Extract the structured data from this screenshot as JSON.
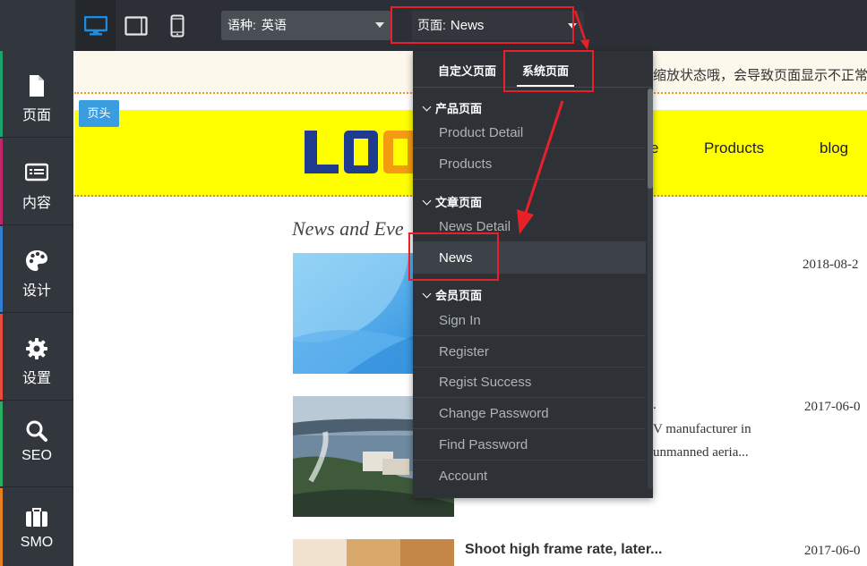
{
  "toolbar": {
    "devices": [
      "desktop-icon",
      "tablet-icon",
      "mobile-icon"
    ],
    "language_label": "语种:",
    "language_value": "英语",
    "page_label": "页面:",
    "page_value": "News"
  },
  "sidebar": {
    "items": [
      {
        "label": "页面",
        "icon": "page-icon",
        "accent": "#1aa36d"
      },
      {
        "label": "内容",
        "icon": "content-icon",
        "accent": "#c0266a"
      },
      {
        "label": "设计",
        "icon": "palette-icon",
        "accent": "#2f7fd6"
      },
      {
        "label": "设置",
        "icon": "gear-icon",
        "accent": "#e74c3c"
      },
      {
        "label": "SEO",
        "icon": "search-icon",
        "accent": "#27ae60"
      },
      {
        "label": "SMO",
        "icon": "briefcase-icon",
        "accent": "#e67e22"
      }
    ]
  },
  "canvas": {
    "notice_text": "缩放状态哦，会导致页面显示不正常",
    "header_tag": "页头",
    "logo_text": "LOO",
    "nav": [
      "e",
      "Products",
      "blog"
    ],
    "news_heading": "News and Eve",
    "dates": [
      "2018-08-2",
      "2017-06-0",
      "2017-06-0"
    ],
    "news_snippet_lines": [
      ".",
      "V manufacturer in",
      "unmanned aeria..."
    ],
    "news_title_3": "Shoot high frame rate, later..."
  },
  "dropdown": {
    "tabs": [
      "自定义页面",
      "系统页面"
    ],
    "active_tab": "系统页面",
    "groups": [
      {
        "title": "产品页面",
        "items": [
          "Product Detail",
          "Products"
        ]
      },
      {
        "title": "文章页面",
        "items": [
          "News Detail",
          "News"
        ]
      },
      {
        "title": "会员页面",
        "items": [
          "Sign In",
          "Register",
          "Regist Success",
          "Change Password",
          "Find Password",
          "Account"
        ]
      }
    ],
    "selected_item": "News"
  },
  "colors": {
    "topbar": "#2c3036",
    "sidebar": "#32373d",
    "dropdown": "#2e3237",
    "header_band": "#ffff00",
    "annotation_red": "#e8202a",
    "device_active": "#1b8ce6"
  }
}
